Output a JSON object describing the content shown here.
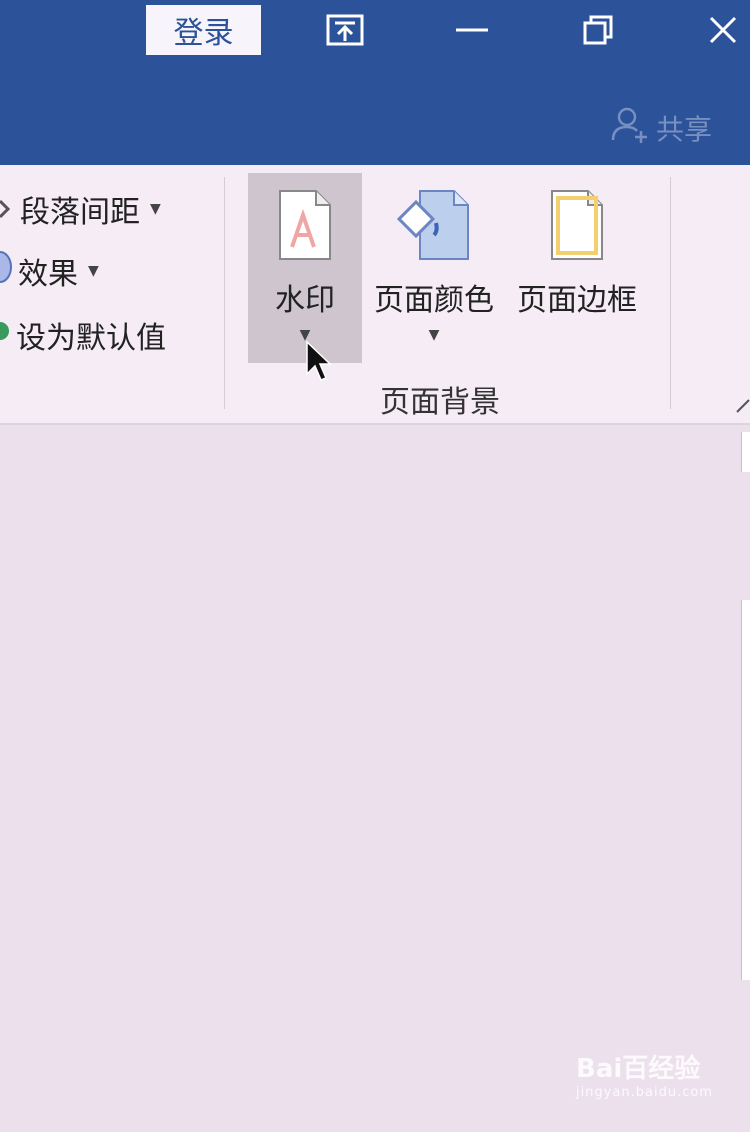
{
  "titlebar": {
    "login_label": "登录",
    "share_label": "共享"
  },
  "paragraph_group": {
    "items": [
      {
        "label": "段落间距"
      },
      {
        "label": "效果"
      },
      {
        "label": "设为默认值"
      }
    ]
  },
  "page_background_group": {
    "label": "页面背景",
    "buttons": [
      {
        "label": "水印",
        "icon": "watermark-icon"
      },
      {
        "label": "页面颜色",
        "icon": "page-color-icon"
      },
      {
        "label": "页面边框",
        "icon": "page-borders-icon"
      }
    ]
  },
  "watermark_brand": {
    "text": "Bai百经验",
    "url": "jingyan.baidu.com"
  },
  "colors": {
    "titlebar": "#2c5299",
    "ribbon": "#f5ecf5",
    "document": "#ebe0eb",
    "hover": "#cfc5cf"
  }
}
